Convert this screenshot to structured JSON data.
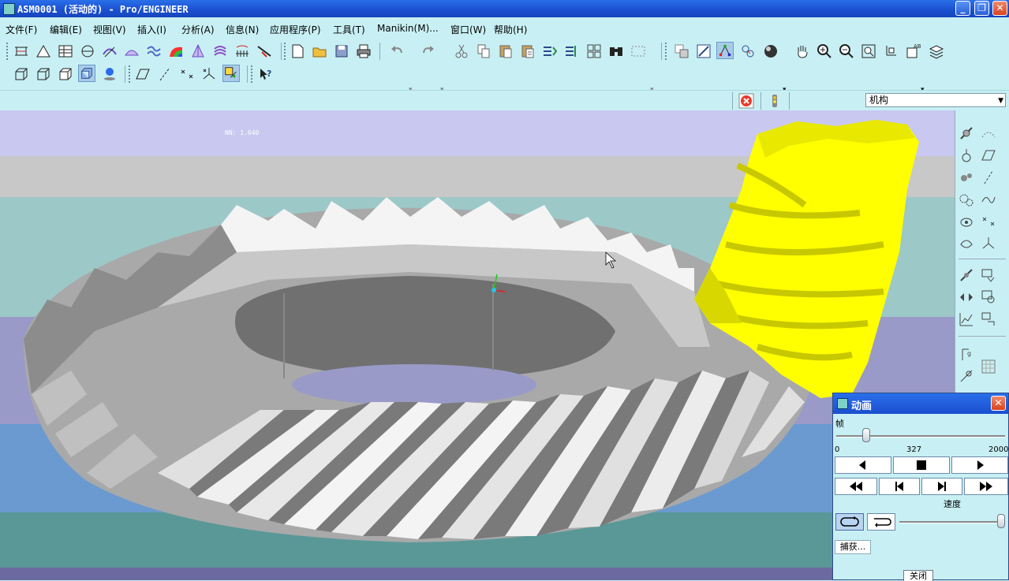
{
  "window": {
    "title": "ASM0001 (活动的) - Pro/ENGINEER",
    "minimize": "_",
    "restore": "❐",
    "close": "✕"
  },
  "menu": [
    "文件(F)",
    "编辑(E)",
    "视图(V)",
    "插入(I)",
    "分析(A)",
    "信息(N)",
    "应用程序(P)",
    "工具(T)",
    "Manikin(M)...",
    "窗口(W)",
    "帮助(H)"
  ],
  "statusbar": {
    "mode_value": "机构"
  },
  "viewport": {
    "overlay_text": "NN: 1.640"
  },
  "animation_dialog": {
    "title": "动画",
    "frame_label": "帧",
    "frame_min": "0",
    "frame_current": "327",
    "frame_max": "2000",
    "speed_label": "速度",
    "capture_button": "捕获...",
    "close_button": "关闭",
    "frame_fraction": 0.16,
    "speed_fraction": 1.0
  },
  "colors": {
    "ui_background": "#c8f0f4",
    "titlebar": "#1a4fd0",
    "gear_gray": "#a9a9a9",
    "pinion_yellow": "#ffff00"
  }
}
